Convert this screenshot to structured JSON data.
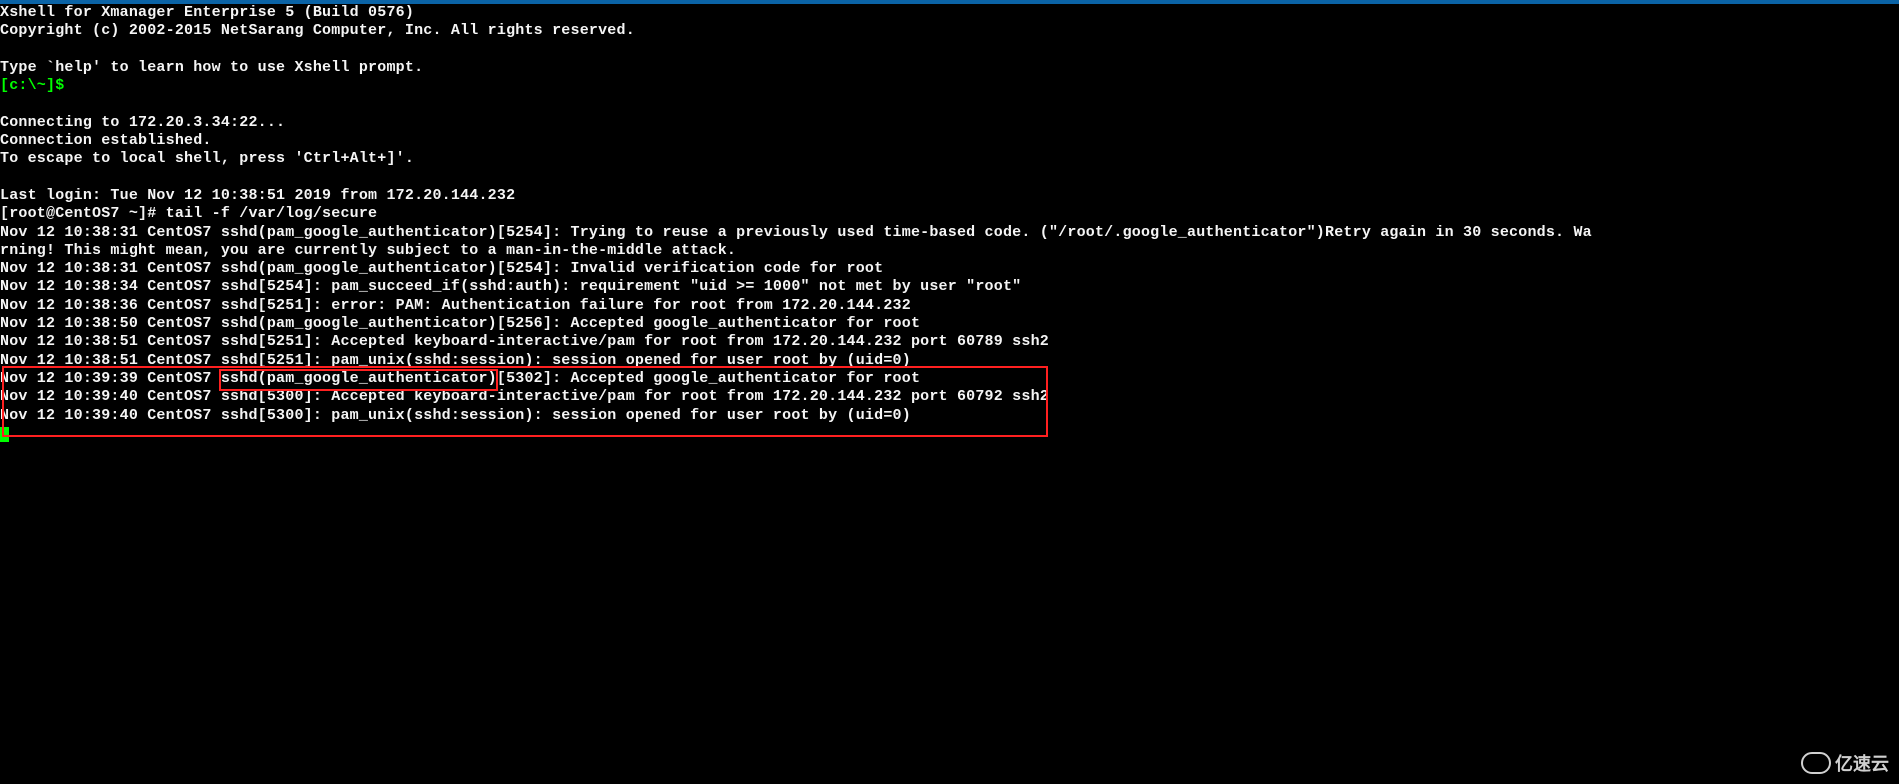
{
  "banner": {
    "line1": "Xshell for Xmanager Enterprise 5 (Build 0576)",
    "line2": "Copyright (c) 2002-2015 NetSarang Computer, Inc. All rights reserved.",
    "blank1": "",
    "help": "Type `help' to learn how to use Xshell prompt.",
    "prompt": "[c:\\~]$ ",
    "blank2": ""
  },
  "conn": {
    "connecting": "Connecting to 172.20.3.34:22...",
    "established": "Connection established.",
    "escape": "To escape to local shell, press 'Ctrl+Alt+]'.",
    "blank": ""
  },
  "session": {
    "lastlogin": "Last login: Tue Nov 12 10:38:51 2019 from 172.20.144.232",
    "cmdline": "[root@CentOS7 ~]# tail -f /var/log/secure"
  },
  "log": [
    "Nov 12 10:38:31 CentOS7 sshd(pam_google_authenticator)[5254]: Trying to reuse a previously used time-based code. (\"/root/.google_authenticator\")Retry again in 30 seconds. Warning! This might mean, you are currently subject to a man-in-the-middle attack.",
    "Nov 12 10:38:31 CentOS7 sshd(pam_google_authenticator)[5254]: Invalid verification code for root",
    "Nov 12 10:38:34 CentOS7 sshd[5254]: pam_succeed_if(sshd:auth): requirement \"uid >= 1000\" not met by user \"root\"",
    "Nov 12 10:38:36 CentOS7 sshd[5251]: error: PAM: Authentication failure for root from 172.20.144.232",
    "Nov 12 10:38:50 CentOS7 sshd(pam_google_authenticator)[5256]: Accepted google_authenticator for root",
    "Nov 12 10:38:51 CentOS7 sshd[5251]: Accepted keyboard-interactive/pam for root from 172.20.144.232 port 60789 ssh2",
    "Nov 12 10:38:51 CentOS7 sshd[5251]: pam_unix(sshd:session): session opened for user root by (uid=0)",
    "Nov 12 10:39:39 CentOS7 sshd(pam_google_authenticator)[5302]: Accepted google_authenticator for root",
    "Nov 12 10:39:40 CentOS7 sshd[5300]: Accepted keyboard-interactive/pam for root from 172.20.144.232 port 60792 ssh2",
    "Nov 12 10:39:40 CentOS7 sshd[5300]: pam_unix(sshd:session): session opened for user root by (uid=0)"
  ],
  "watermark": "亿速云"
}
